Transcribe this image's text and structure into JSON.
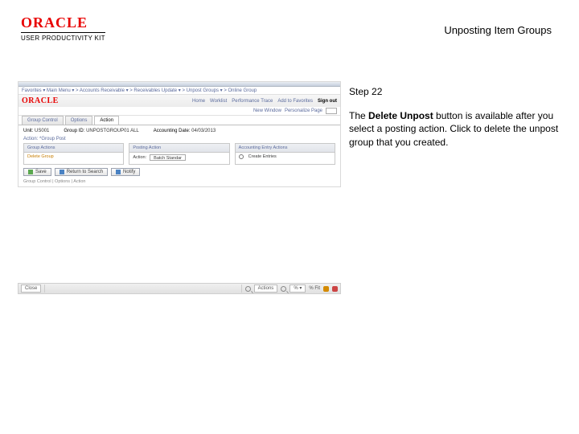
{
  "header": {
    "brand": "ORACLE",
    "product_line": "USER PRODUCTIVITY KIT",
    "doc_title": "Unposting Item Groups"
  },
  "instruction": {
    "step_label": "Step 22",
    "text_before_bold": "The ",
    "bold": "Delete Unpost",
    "text_after_bold": " button is available after you select a posting action. Click to delete the unpost group that you created."
  },
  "mini": {
    "breadcrumb": "Favorites ▾   Main Menu ▾   > Accounts Receivable ▾ > Receivables Update ▾ > Unpost Groups ▾ > Online Group",
    "brand": "ORACLE",
    "nav_links": [
      "Home",
      "Worklist",
      "Performance Trace",
      "Add to Favorites"
    ],
    "signout": "Sign out",
    "new_window": "New Window",
    "personalize": "Personalize Page",
    "tabs": [
      "Group Control",
      "Options",
      "Action"
    ],
    "active_tab": 2,
    "info_row": {
      "unit_lbl": "Unit:",
      "unit_val": "US001",
      "group_lbl": "Group ID:",
      "group_val": "UNPOSTGROUP01  ALL",
      "date_lbl": "Accounting Date:",
      "date_val": "04/03/2013"
    },
    "action_title": "Action:   *Group Post",
    "columns": {
      "group_actions": {
        "head": "Group Actions",
        "item1": "Delete Group"
      },
      "posting_action": {
        "head": "Posting Action",
        "lbl": "Action:",
        "val": "Batch Standar"
      },
      "accounting": {
        "head": "Accounting Entry Actions",
        "opt": "Create Entries"
      }
    },
    "buttons": {
      "save": "Save",
      "return": "Return to Search",
      "notify": "Notify"
    },
    "bottom_links": [
      "Group Control",
      "Options",
      "Action"
    ]
  },
  "footer": {
    "close": "Close",
    "actions": "Actions",
    "zoom_opt": "% ▾",
    "fit": "% Fit"
  }
}
